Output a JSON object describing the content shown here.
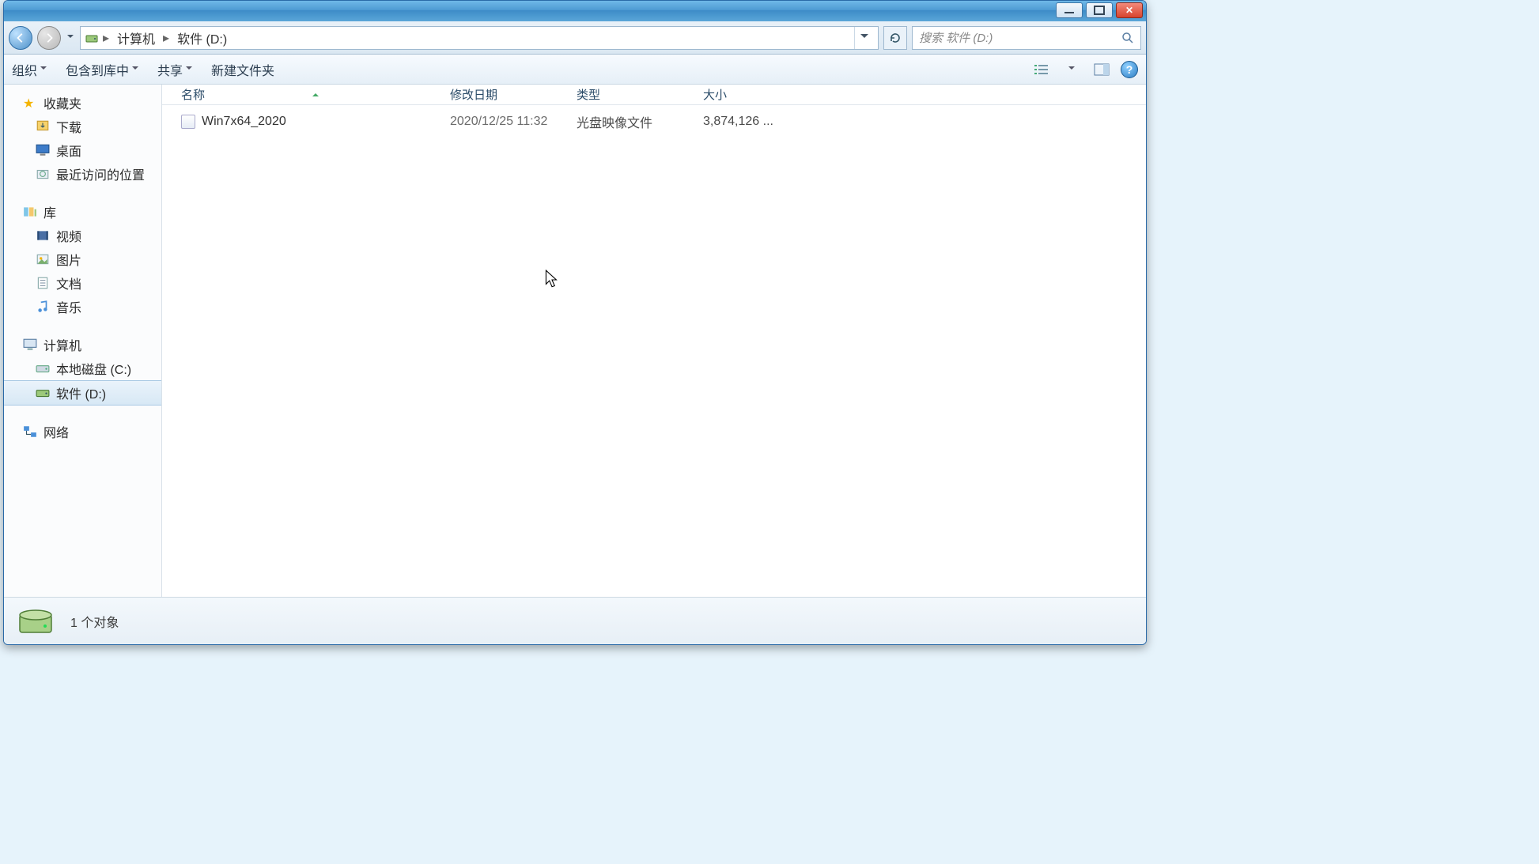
{
  "address": {
    "crumb1": "计算机",
    "crumb2": "软件 (D:)"
  },
  "search": {
    "placeholder": "搜索 软件 (D:)"
  },
  "toolbar": {
    "organize": "组织",
    "include": "包含到库中",
    "share": "共享",
    "newfolder": "新建文件夹"
  },
  "sidebar": {
    "favorites": "收藏夹",
    "downloads": "下载",
    "desktop": "桌面",
    "recent": "最近访问的位置",
    "libraries": "库",
    "videos": "视频",
    "pictures": "图片",
    "documents": "文档",
    "music": "音乐",
    "computer": "计算机",
    "drive_c": "本地磁盘 (C:)",
    "drive_d": "软件 (D:)",
    "network": "网络"
  },
  "columns": {
    "name": "名称",
    "date": "修改日期",
    "type": "类型",
    "size": "大小"
  },
  "files": [
    {
      "name": "Win7x64_2020",
      "date": "2020/12/25 11:32",
      "type": "光盘映像文件",
      "size": "3,874,126 ..."
    }
  ],
  "status": {
    "text": "1 个对象"
  }
}
